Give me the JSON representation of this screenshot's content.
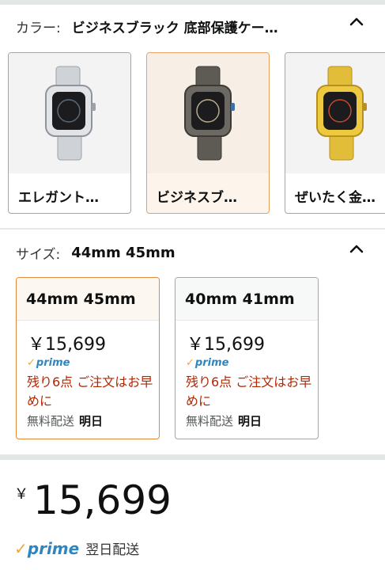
{
  "color_section": {
    "label": "カラー:",
    "selected_value": "ビジネスブラック 底部保護ケー…",
    "swatches": [
      {
        "label": "エレガント…",
        "selected": false,
        "icon": "silver-watch-image"
      },
      {
        "label": "ビジネスブ…",
        "selected": true,
        "icon": "gray-watch-image"
      },
      {
        "label": "ぜいたく金…",
        "selected": false,
        "icon": "gold-watch-image"
      }
    ]
  },
  "size_section": {
    "label": "サイズ:",
    "selected_value": "44mm 45mm",
    "options": [
      {
        "title": "44mm 45mm",
        "price": "￥15,699",
        "prime": "prime",
        "stock": "残り6点 ご注文はお早めに",
        "shipping_label": "無料配送",
        "shipping_day": "明日",
        "selected": true
      },
      {
        "title": "40mm 41mm",
        "price": "￥15,699",
        "prime": "prime",
        "stock": "残り6点 ご注文はお早めに",
        "shipping_label": "無料配送",
        "shipping_day": "明日",
        "selected": false
      }
    ]
  },
  "price_block": {
    "currency": "￥",
    "amount": "15,699",
    "prime": "prime",
    "delivery": "翌日配送"
  },
  "colors": {
    "selected_border": "#e0893e",
    "stock_text": "#b12704",
    "prime_blue": "#2e86c1",
    "prime_check": "#f0a43c"
  }
}
